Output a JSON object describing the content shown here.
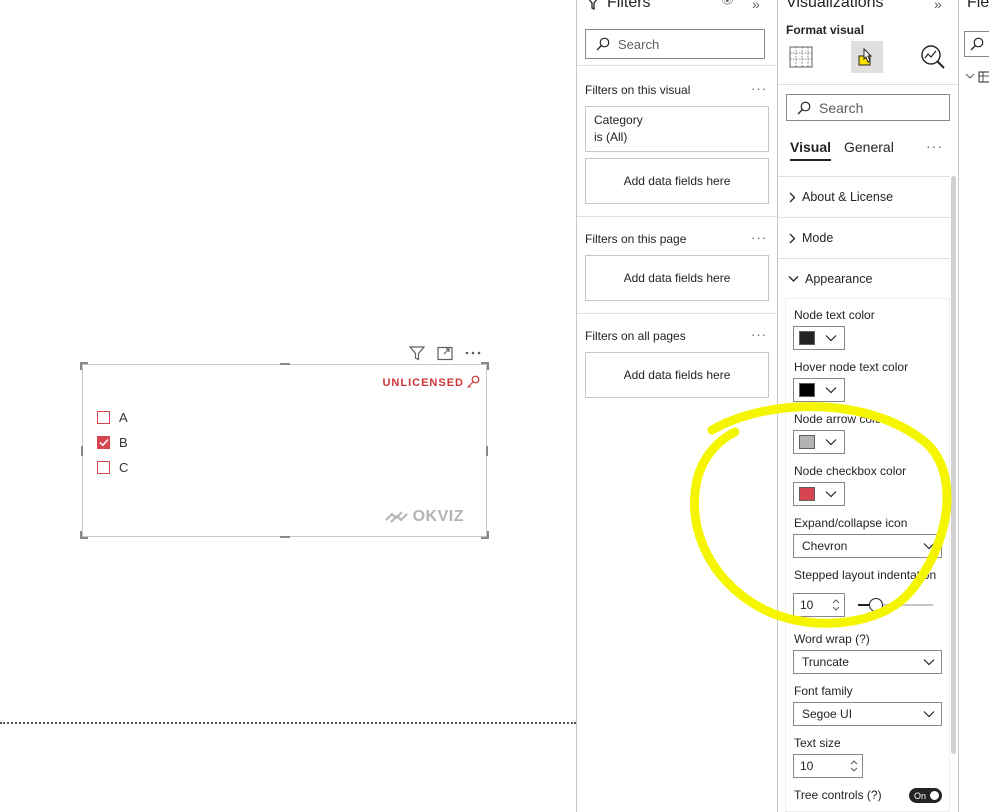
{
  "visual": {
    "unlicensed_label": "UNLICENSED",
    "brand_label": "OKVIZ",
    "items": [
      {
        "label": "A",
        "checked": false
      },
      {
        "label": "B",
        "checked": true
      },
      {
        "label": "C",
        "checked": false
      }
    ],
    "accent_color": "#d64550"
  },
  "filters": {
    "title": "Filters",
    "search_placeholder": "Search",
    "on_visual_label": "Filters on this visual",
    "category_field": "Category",
    "category_condition": "is (All)",
    "add_fields_visual": "Add data fields here",
    "on_page_label": "Filters on this page",
    "add_fields_page": "Add data fields here",
    "on_all_pages_label": "Filters on all pages",
    "add_fields_all": "Add data fields here"
  },
  "visualizations": {
    "title": "Visualizations",
    "format_visual_label": "Format visual",
    "search_placeholder": "Search",
    "tabs": {
      "visual": "Visual",
      "general": "General"
    },
    "sections": {
      "about": "About & License",
      "mode": "Mode",
      "appearance": "Appearance"
    },
    "props": {
      "node_text_color": {
        "label": "Node text color",
        "color": "#252423"
      },
      "hover_node_text_color": {
        "label": "Hover node text color",
        "color": "#000000"
      },
      "node_arrow_color": {
        "label": "Node arrow color",
        "color": "#b3b3b3"
      },
      "node_checkbox_color": {
        "label": "Node checkbox color",
        "color": "#d64550"
      },
      "expand_collapse_icon": {
        "label": "Expand/collapse icon",
        "value": "Chevron"
      },
      "stepped_layout_indentation": {
        "label": "Stepped layout indentation",
        "value": "10",
        "slider_fraction": 0.24
      },
      "word_wrap": {
        "label": "Word wrap (?)",
        "value": "Truncate"
      },
      "font_family": {
        "label": "Font family",
        "value": "Segoe UI"
      },
      "text_size": {
        "label": "Text size",
        "value": "10"
      },
      "tree_controls": {
        "label": "Tree controls (?)",
        "toggle": "On"
      }
    }
  },
  "fields": {
    "title": "Fiel"
  },
  "annotation": {
    "highlight_color": "#f5f500"
  }
}
